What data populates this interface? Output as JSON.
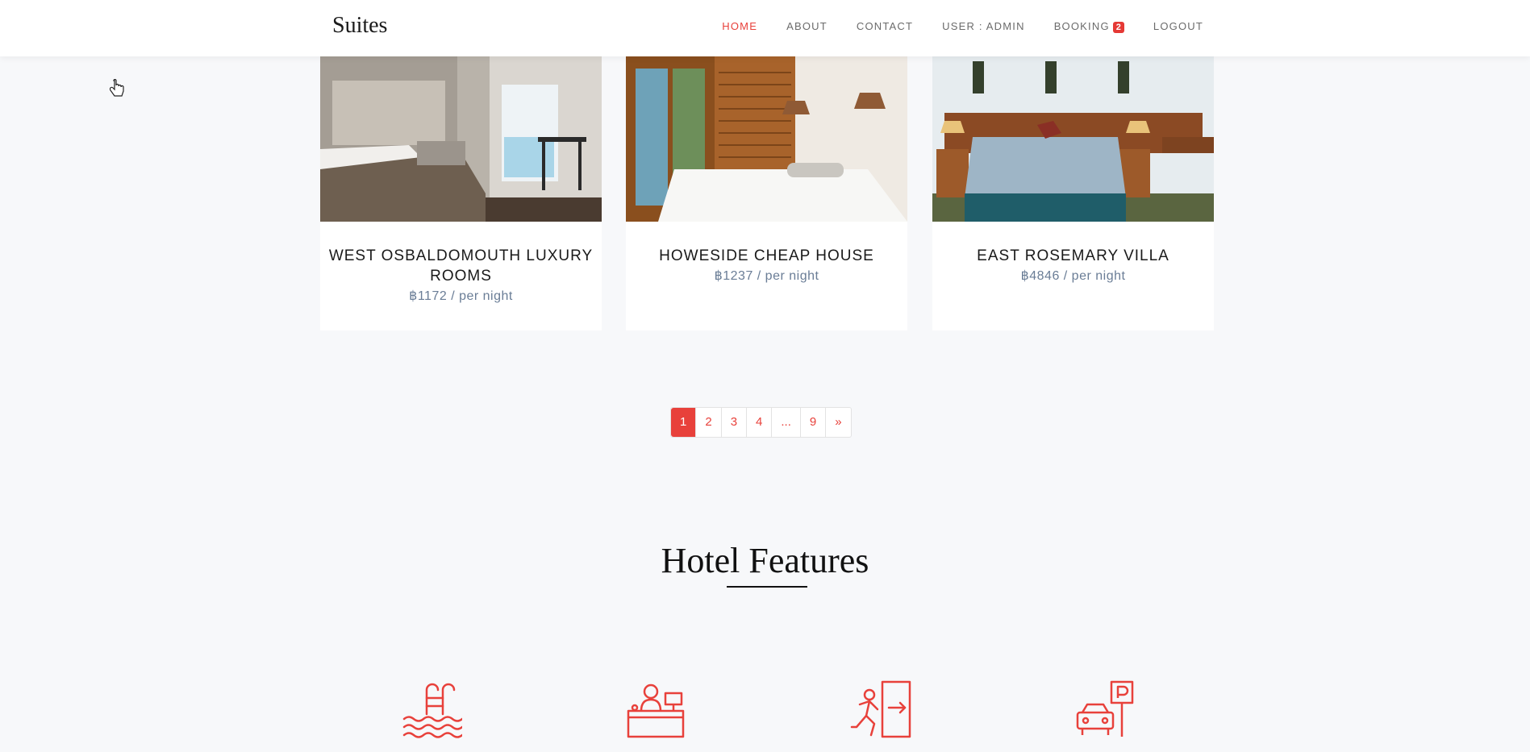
{
  "navbar": {
    "brand": "Suites",
    "links": [
      {
        "label": "HOME",
        "active": true
      },
      {
        "label": "ABOUT"
      },
      {
        "label": "CONTACT"
      },
      {
        "label": "USER : ADMIN"
      },
      {
        "label": "BOOKING",
        "badge": "2"
      },
      {
        "label": "LOGOUT"
      }
    ]
  },
  "rooms": [
    {
      "title": "WEST OSBALDOMOUTH LUXURY ROOMS",
      "price": "฿1172 / per night"
    },
    {
      "title": "HOWESIDE CHEAP HOUSE",
      "price": "฿1237 / per night"
    },
    {
      "title": "EAST ROSEMARY VILLA",
      "price": "฿4846 / per night"
    }
  ],
  "pagination": {
    "pages": [
      "1",
      "2",
      "3",
      "4",
      "...",
      "9",
      "»"
    ],
    "current": "1"
  },
  "features": {
    "title": "Hotel Features",
    "icons": [
      "swimming-pool-icon",
      "reception-desk-icon",
      "emergency-exit-icon",
      "parking-icon"
    ],
    "accent_color": "#e8413b"
  }
}
